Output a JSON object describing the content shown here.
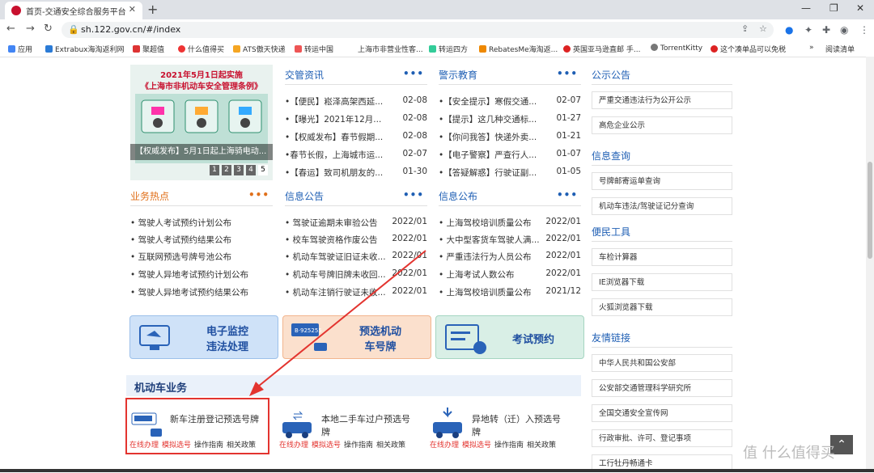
{
  "browser": {
    "tab_title": "首页-交通安全综合服务平台",
    "url": "sh.122.gov.cn/#/index",
    "bookmarks": [
      "应用",
      "Extrabux海淘返利网",
      "聚超值",
      "什么值得买",
      "ATS傲天快递",
      "转运中国",
      "上海市非营业性客...",
      "转运四方",
      "RebatesMe海淘返...",
      "英国亚马逊直邮 手...",
      "TorrentKitty",
      "这个凑单品可以免税",
      "阅读清单"
    ]
  },
  "banner": {
    "title1": "2021年5月1日起实施",
    "title2": "《上海市非机动车安全管理条例》",
    "caption": "【权威发布】5月1日起上海骑电动...",
    "pages": [
      "1",
      "2",
      "3",
      "4",
      "5"
    ],
    "active_page": 5
  },
  "jiaoguan": {
    "title": "交管资讯",
    "more": "•••",
    "items": [
      {
        "t": "•【便民】崧泽高架西延...",
        "d": "02-08"
      },
      {
        "t": "•【曝光】2021年12月...",
        "d": "02-08"
      },
      {
        "t": "•【权威发布】春节假期...",
        "d": "02-08"
      },
      {
        "t": "•春节长假，上海城市运...",
        "d": "02-07"
      },
      {
        "t": "•【春运】致司机朋友的...",
        "d": "01-30"
      }
    ]
  },
  "jingmin": {
    "title": "警示教育",
    "more": "•••",
    "items": [
      {
        "t": "•【安全提示】寒假交通...",
        "d": "02-07"
      },
      {
        "t": "•【提示】这几种交通标...",
        "d": "01-27"
      },
      {
        "t": "•【你问我答】快递外卖...",
        "d": "01-21"
      },
      {
        "t": "•【电子警察】严查行人...",
        "d": "01-07"
      },
      {
        "t": "•【答疑解惑】行驶证副...",
        "d": "01-05"
      }
    ]
  },
  "hot": {
    "title": "业务热点",
    "more": "•••",
    "items": [
      {
        "t": "• 驾驶人考试预约计划公布"
      },
      {
        "t": "• 驾驶人考试预约结果公布"
      },
      {
        "t": "• 互联网预选号牌号池公布"
      },
      {
        "t": "• 驾驶人异地考试预约计划公布"
      },
      {
        "t": "• 驾驶人异地考试预约结果公布"
      }
    ]
  },
  "xinxi_gonggao": {
    "title": "信息公告",
    "more": "•••",
    "items": [
      {
        "t": "• 驾驶证逾期未审验公告",
        "d": "2022/01"
      },
      {
        "t": "• 校车驾驶资格作废公告",
        "d": "2022/01"
      },
      {
        "t": "• 机动车驾驶证旧证未收...",
        "d": "2022/01"
      },
      {
        "t": "• 机动车号牌旧牌未收回...",
        "d": "2022/01"
      },
      {
        "t": "• 机动车注销行驶证未收...",
        "d": "2022/01"
      }
    ]
  },
  "xinxi_gongbu": {
    "title": "信息公布",
    "more": "•••",
    "items": [
      {
        "t": "• 上海驾校培训质量公布",
        "d": "2022/01"
      },
      {
        "t": "• 大中型客货车驾驶人满...",
        "d": "2022/01"
      },
      {
        "t": "• 严重违法行为人员公布",
        "d": "2022/01"
      },
      {
        "t": "• 上海考试人数公布",
        "d": "2022/01"
      },
      {
        "t": "• 上海驾校培训质量公布",
        "d": "2021/12"
      }
    ]
  },
  "cards": [
    {
      "l1": "电子监控",
      "l2": "违法处理"
    },
    {
      "l1": "预选机动",
      "l2": "车号牌"
    },
    {
      "l1": "考试预约",
      "l2": ""
    }
  ],
  "vehicle": {
    "title": "机动车业务",
    "items": [
      {
        "name": "新车注册登记预选号牌",
        "links": [
          "在线办理",
          "模拟选号",
          "操作指南",
          "相关政策"
        ]
      },
      {
        "name": "本地二手车过户预选号牌",
        "links": [
          "在线办理",
          "模拟选号",
          "操作指南",
          "相关政策"
        ]
      },
      {
        "name": "异地转（迁）入预选号牌",
        "links": [
          "在线办理",
          "模拟选号",
          "操作指南",
          "相关政策"
        ]
      }
    ]
  },
  "right": {
    "gonggao": {
      "title": "公示公告",
      "items": [
        "严重交通违法行为公开公示",
        "高危企业公示"
      ]
    },
    "chaxun": {
      "title": "信息查询",
      "items": [
        "号牌邮寄运单查询",
        "机动车违法/驾驶证记分查询"
      ]
    },
    "gongju": {
      "title": "便民工具",
      "items": [
        "车检计算器",
        "IE浏览器下载",
        "火狐浏览器下载"
      ]
    },
    "links": {
      "title": "友情链接",
      "items": [
        "中华人民共和国公安部",
        "公安部交通管理科学研究所",
        "全国交通安全宣传网",
        "行政审批、许可、登记事项",
        "工行牡丹畅通卡"
      ]
    }
  },
  "watermark": "值 什么值得买"
}
